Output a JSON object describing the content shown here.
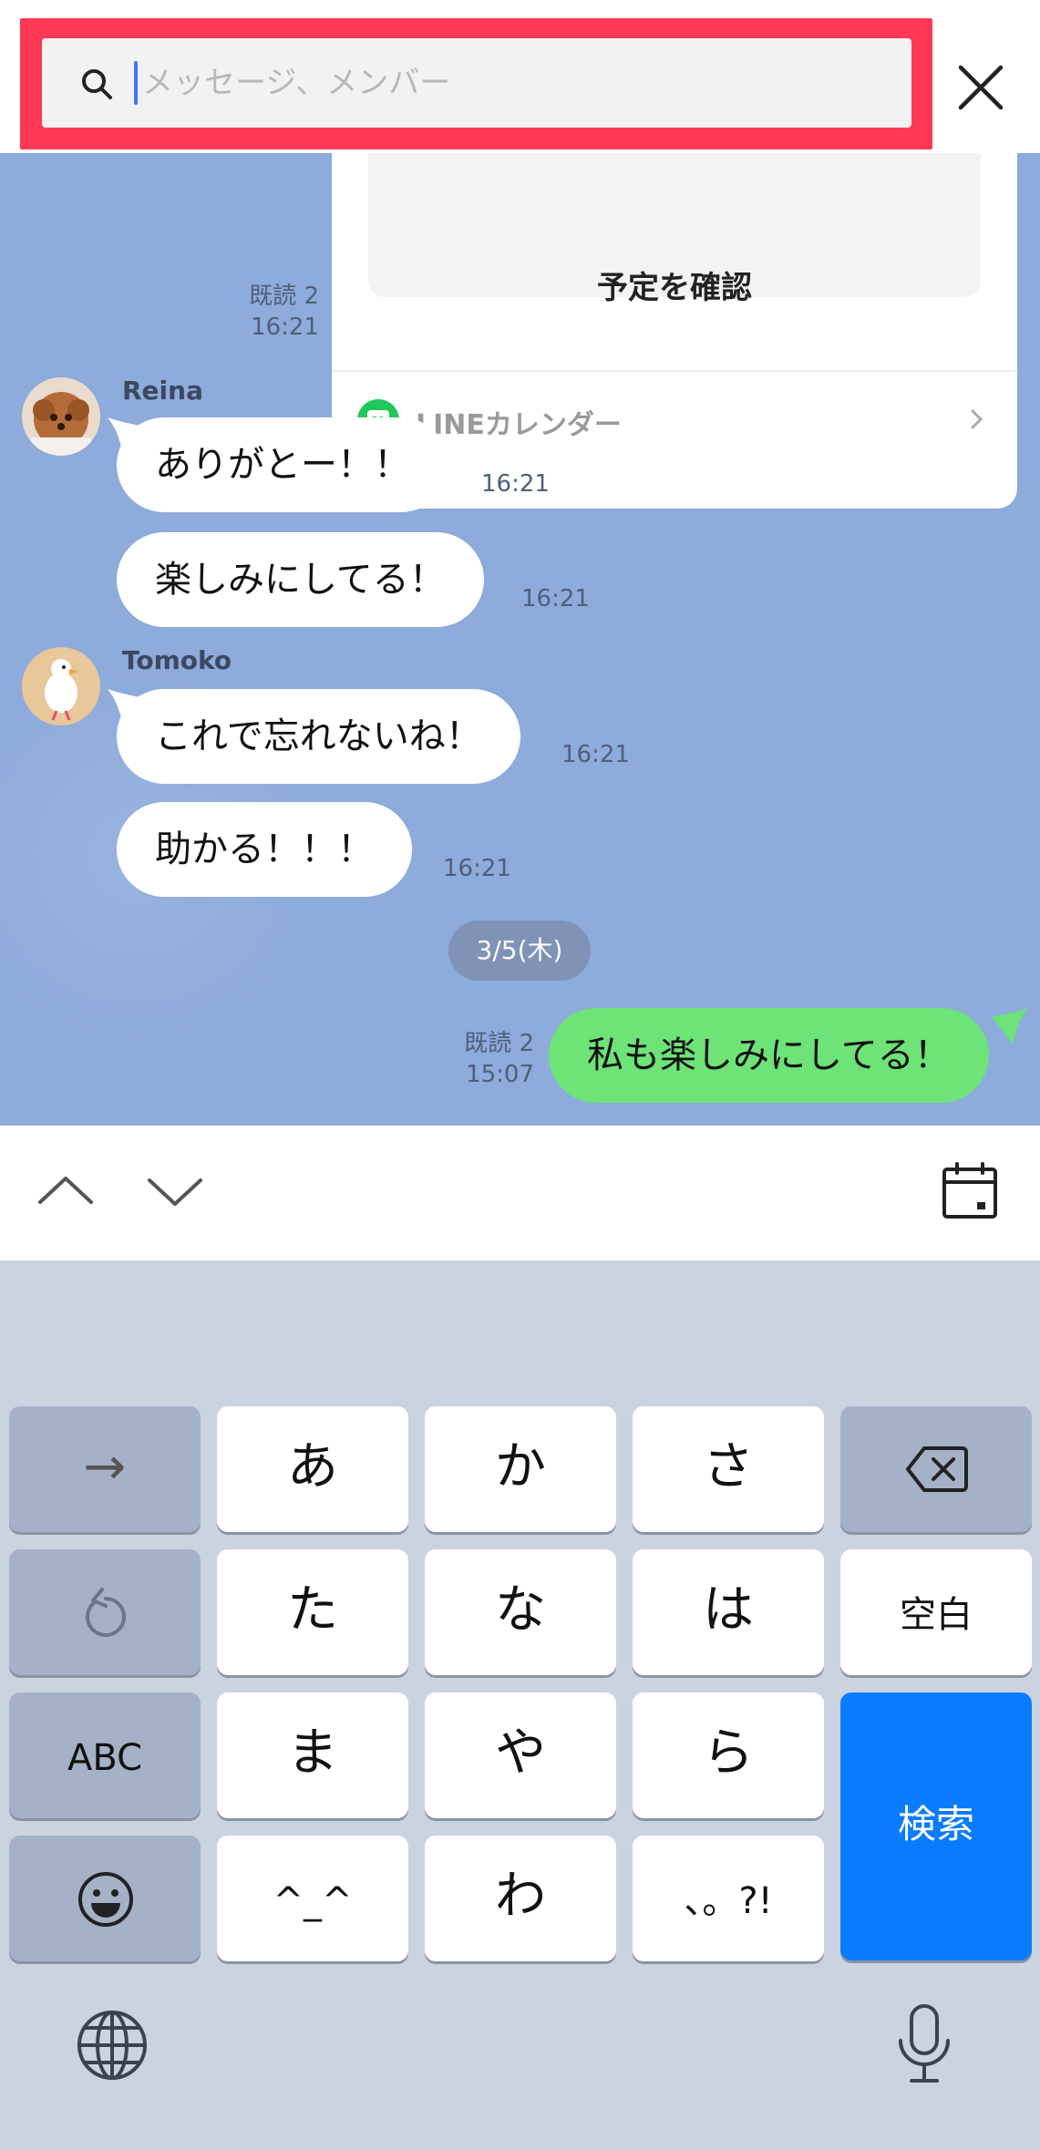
{
  "search": {
    "placeholder": "メッセージ、メンバー",
    "value": ""
  },
  "calendar_card": {
    "button_label": "予定を確認",
    "footer_label": "LINEカレンダー",
    "app_icon_label": "31"
  },
  "messages": [
    {
      "read_status": "既読 2",
      "time": "16:21"
    },
    {
      "sender": "Reina",
      "text": "ありがとー！！",
      "time": "16:21"
    },
    {
      "text": "楽しみにしてる！",
      "time": "16:21"
    },
    {
      "sender": "Tomoko",
      "text": "これで忘れないね！",
      "time": "16:21"
    },
    {
      "text": "助かる！！！",
      "time": "16:21"
    },
    {
      "date_separator": "3/5(木)"
    },
    {
      "read_status": "既読 2",
      "time": "15:07",
      "text": "私も楽しみにしてる！",
      "mine": true
    }
  ],
  "toolbar": {
    "icons": [
      "chevron-up-icon",
      "chevron-down-icon",
      "calendar-icon"
    ]
  },
  "keyboard": {
    "rows": [
      [
        "→",
        "あ",
        "か",
        "さ",
        "delete-icon"
      ],
      [
        "undo-icon",
        "た",
        "な",
        "は",
        "空白"
      ],
      [
        "ABC",
        "ま",
        "や",
        "ら",
        "検索"
      ],
      [
        "emoji-icon",
        "^_^",
        "わ",
        "、。?!"
      ]
    ],
    "key_arrow": "→",
    "key_a": "あ",
    "key_ka": "か",
    "key_sa": "さ",
    "key_ta": "た",
    "key_na": "な",
    "key_ha": "は",
    "key_space": "空白",
    "key_abc": "ABC",
    "key_ma": "ま",
    "key_ya": "や",
    "key_ra": "ら",
    "key_search": "検索",
    "key_kaomoji": "^_^",
    "key_wa": "わ",
    "key_punct": "、。?!"
  },
  "colors": {
    "highlight": "#fe3855",
    "chat_background": "#8dabdb",
    "my_bubble": "#6de378",
    "search_key": "#0a7cff"
  }
}
